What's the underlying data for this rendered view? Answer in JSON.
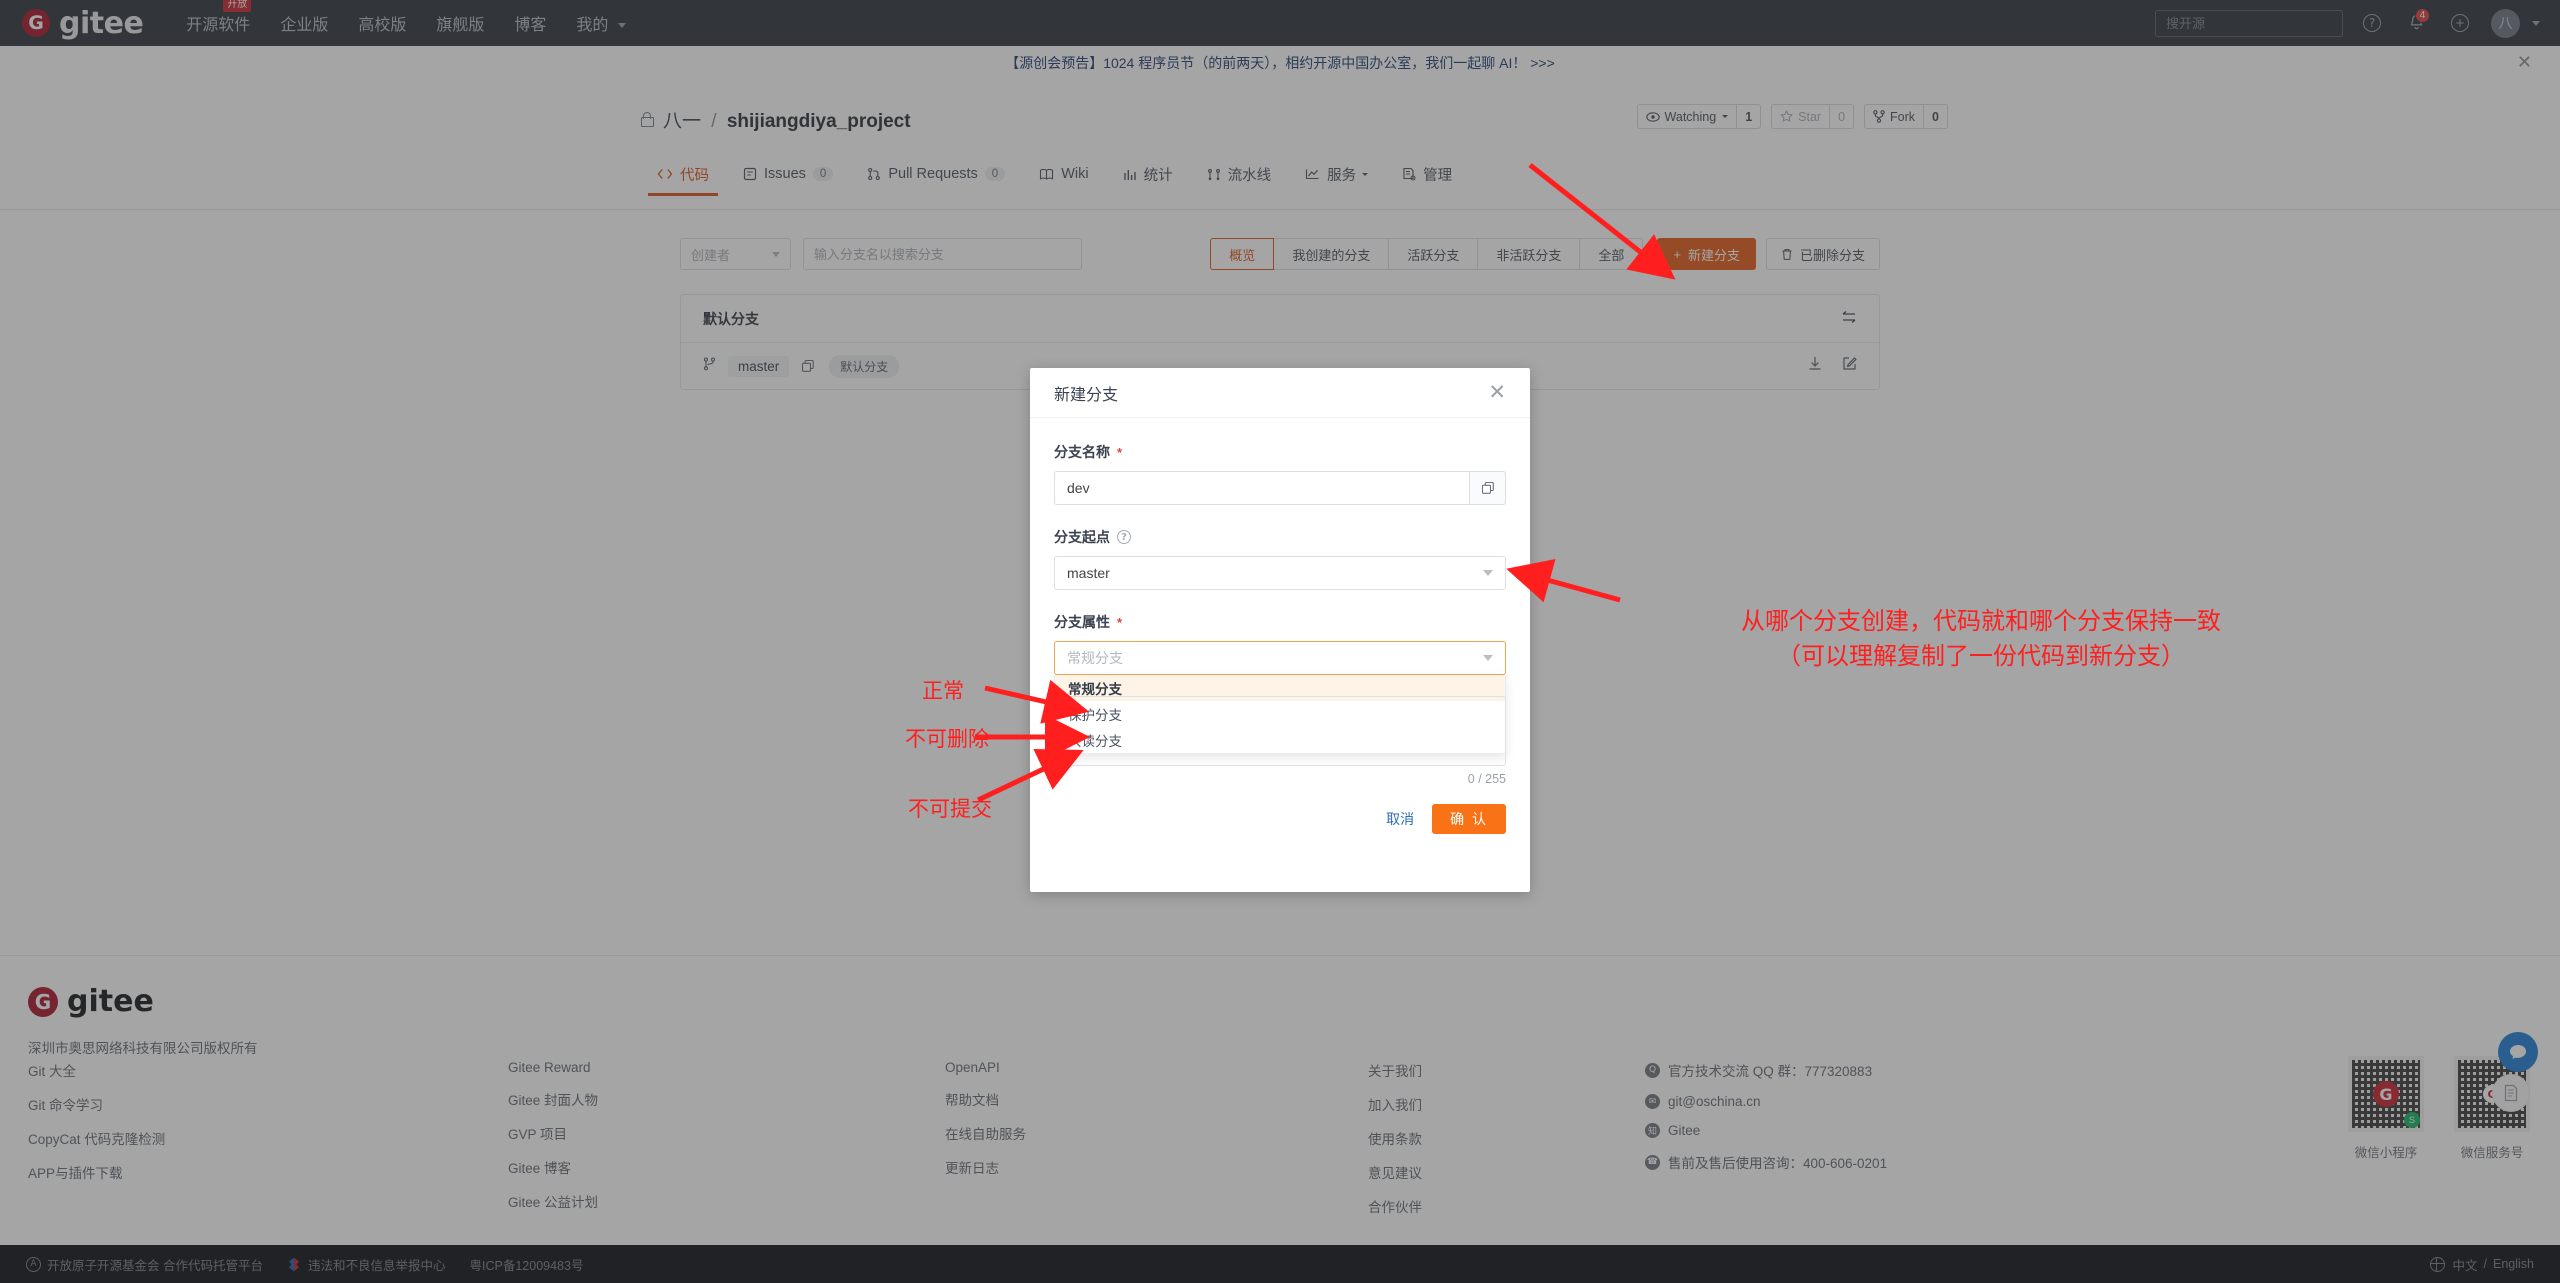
{
  "colors": {
    "brand_orange": "#e35b1a",
    "accent_red": "#ff1f1f",
    "nav_bg": "#2f353c",
    "logo_red": "#a8152a"
  },
  "topnav": {
    "logo_glyph": "G",
    "logo_text": "gitee",
    "items": [
      {
        "label": "开源软件",
        "badge": "开放"
      },
      {
        "label": "企业版",
        "badge": ""
      },
      {
        "label": "高校版",
        "badge": ""
      },
      {
        "label": "旗舰版",
        "badge": ""
      },
      {
        "label": "博客",
        "badge": ""
      },
      {
        "label": "我的",
        "badge": "",
        "caret": true
      }
    ],
    "search_placeholder": "搜开源",
    "help_glyph": "?",
    "notification_count": "4",
    "plus_glyph": "+",
    "avatar_text": "八"
  },
  "announce": {
    "text": "【源创会预告】1024 程序员节（的前两天），相约开源中国办公室，我们一起聊 AI！ >>>",
    "close_glyph": "✕"
  },
  "repo": {
    "owner": "八一",
    "separator": "/",
    "name": "shijiangdiya_project",
    "watching_label": "Watching",
    "watching_count": "1",
    "star_label": "Star",
    "star_count": "0",
    "fork_label": "Fork",
    "fork_count": "0"
  },
  "tabs": [
    {
      "label": "代码",
      "count": "",
      "active": true
    },
    {
      "label": "Issues",
      "count": "0",
      "active": false
    },
    {
      "label": "Pull Requests",
      "count": "0",
      "active": false
    },
    {
      "label": "Wiki",
      "count": "",
      "active": false
    },
    {
      "label": "统计",
      "count": "",
      "active": false
    },
    {
      "label": "流水线",
      "count": "",
      "active": false
    },
    {
      "label": "服务",
      "count": "",
      "active": false,
      "caret": true
    },
    {
      "label": "管理",
      "count": "",
      "active": false
    }
  ],
  "filter_bar": {
    "creator_select": "创建者",
    "search_placeholder": "输入分支名以搜索分支",
    "segments": [
      {
        "label": "概览",
        "active": true
      },
      {
        "label": "我创建的分支",
        "active": false
      },
      {
        "label": "活跃分支",
        "active": false
      },
      {
        "label": "非活跃分支",
        "active": false
      },
      {
        "label": "全部",
        "active": false
      }
    ],
    "new_branch_label": "新建分支",
    "new_branch_plus": "+",
    "deleted_branch_label": "已删除分支"
  },
  "branch_panel": {
    "header": "默认分支",
    "rows": [
      {
        "name": "master",
        "tag": "默认分支"
      }
    ]
  },
  "modal": {
    "title": "新建分支",
    "close_glyph": "✕",
    "branch_name_label": "分支名称",
    "branch_name_value": "dev",
    "branch_name_required": "*",
    "branch_start_label": "分支起点",
    "branch_start_value": "master",
    "branch_attr_label": "分支属性",
    "branch_attr_required": "*",
    "branch_attr_placeholder": "常规分支",
    "branch_attr_options": [
      {
        "label": "常规分支",
        "selected": true
      },
      {
        "label": "保护分支",
        "selected": false
      },
      {
        "label": "只读分支",
        "selected": false
      }
    ],
    "char_count": "0 / 255",
    "cancel_label": "取消",
    "confirm_label": "确 认",
    "help_glyph": "?"
  },
  "annotations": {
    "normal": "正常",
    "no_delete": "不可删除",
    "no_commit": "不可提交",
    "right_line1": "从哪个分支创建，代码就和哪个分支保持一致",
    "right_line2": "（可以理解复制了一份代码到新分支）"
  },
  "footer": {
    "logo_glyph": "G",
    "logo_text": "gitee",
    "copyright": "深圳市奥思网络科技有限公司版权所有",
    "col1": [
      "Git 大全",
      "Git 命令学习",
      "CopyCat 代码克隆检测",
      "APP与插件下载"
    ],
    "col2": [
      "Gitee Reward",
      "Gitee 封面人物",
      "GVP 项目",
      "Gitee 博客",
      "Gitee 公益计划"
    ],
    "col3": [
      "OpenAPI",
      "帮助文档",
      "在线自助服务",
      "更新日志"
    ],
    "col4": [
      "关于我们",
      "加入我们",
      "使用条款",
      "意见建议",
      "合作伙伴"
    ],
    "col5": [
      {
        "icon": "qq-icon",
        "icon_glyph": "Q",
        "label": "官方技术交流 QQ 群：777320883"
      },
      {
        "icon": "mail-icon",
        "icon_glyph": "✉",
        "label": "git@oschina.cn"
      },
      {
        "icon": "zhihu-icon",
        "icon_glyph": "知",
        "label": "Gitee"
      },
      {
        "icon": "phone-icon",
        "icon_glyph": "☎",
        "label": "售前及售后使用咨询：400-606-0201"
      }
    ],
    "qr": [
      {
        "label": "微信小程序",
        "center_glyph": "G"
      },
      {
        "label": "微信服务号",
        "center_glyph": "G"
      }
    ]
  },
  "bottombar": {
    "foundation": "开放原子开源基金会 合作代码托管平台",
    "report": "违法和不良信息举报中心",
    "icp": "粤ICP备12009483号",
    "lang_cn": "中文",
    "lang_sep": "/",
    "lang_en": "English"
  }
}
